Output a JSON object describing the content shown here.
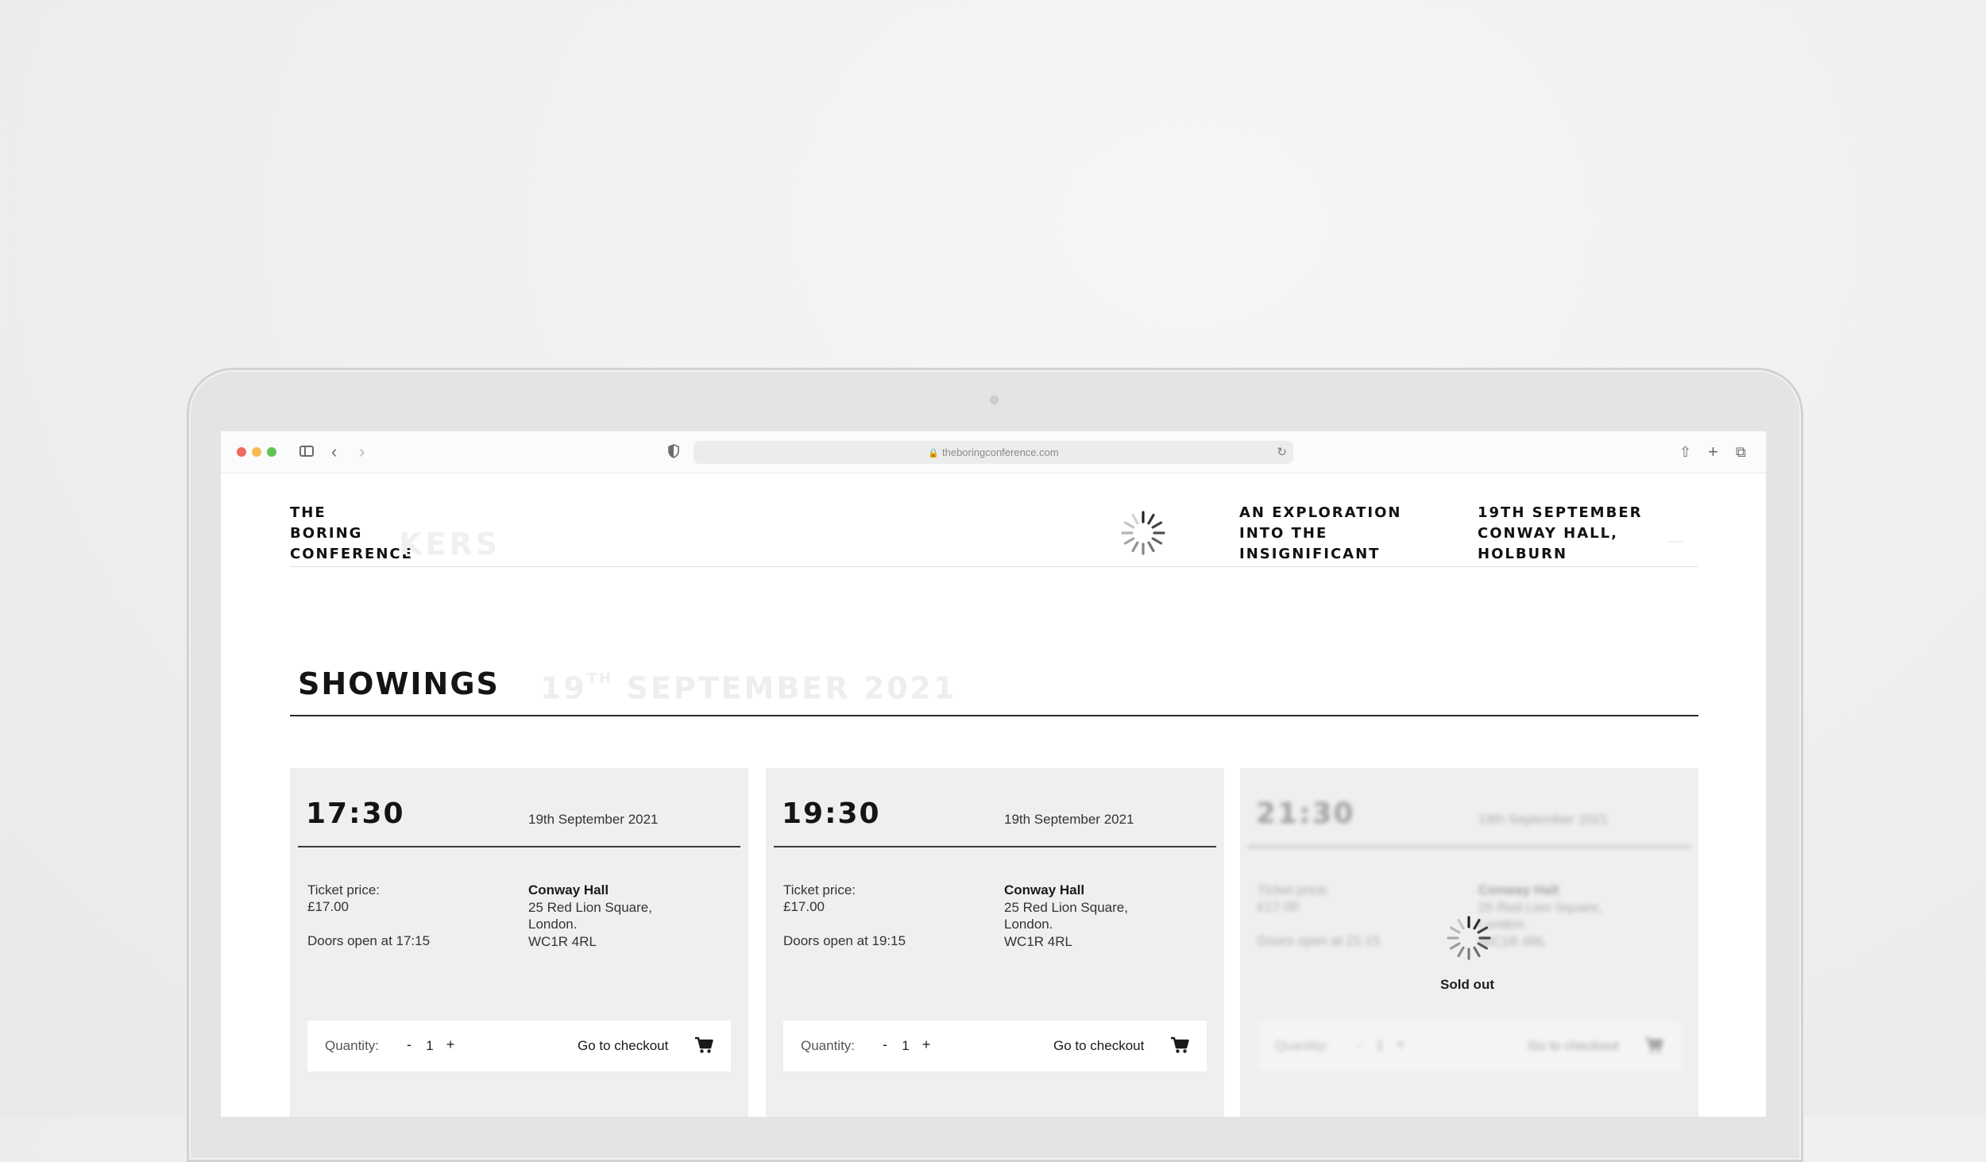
{
  "browser": {
    "url": "theboringconference.com"
  },
  "header": {
    "logo_lines": [
      "THE",
      "BORING",
      "CONFERENCE"
    ],
    "ghost_nav": "KERS",
    "tagline_lines": [
      "AN EXPLORATION",
      "INTO THE",
      "INSIGNIFICANT"
    ],
    "details_lines": [
      "19TH SEPTEMBER",
      "CONWAY HALL,",
      "HOLBURN"
    ]
  },
  "showings": {
    "title": "SHOWINGS",
    "date_prefix": "19",
    "date_sup": "TH",
    "date_rest": "SEPTEMBER 2021",
    "cards": [
      {
        "time": "17:30",
        "date": "19th September 2021",
        "price_label": "Ticket price:",
        "price": "£17.00",
        "doors": "Doors open at 17:15",
        "venue_name": "Conway Hall",
        "venue_lines": [
          "25 Red Lion Square,",
          "London.",
          "WC1R 4RL"
        ],
        "quantity_label": "Quantity:",
        "minus": "-",
        "quantity": "1",
        "plus": "+",
        "checkout": "Go to checkout",
        "sold_out": false
      },
      {
        "time": "19:30",
        "date": "19th September 2021",
        "price_label": "Ticket price:",
        "price": "£17.00",
        "doors": "Doors open at 19:15",
        "venue_name": "Conway Hall",
        "venue_lines": [
          "25 Red Lion Square,",
          "London.",
          "WC1R 4RL"
        ],
        "quantity_label": "Quantity:",
        "minus": "-",
        "quantity": "1",
        "plus": "+",
        "checkout": "Go to checkout",
        "sold_out": false
      },
      {
        "time": "21:30",
        "date": "19th September 2021",
        "price_label": "Ticket price:",
        "price": "£17.00",
        "doors": "Doors open at 21:15",
        "venue_name": "Conway Hall",
        "venue_lines": [
          "25 Red Lion Square,",
          "London.",
          "WC1R 4RL"
        ],
        "quantity_label": "Quantity:",
        "minus": "-",
        "quantity": "1",
        "plus": "+",
        "checkout": "Go to checkout",
        "sold_out": true,
        "sold_out_label": "Sold out"
      }
    ]
  },
  "icons": {
    "spinner": "loading-spinner-icon",
    "cart": "shopping-cart-icon",
    "lock": "lock-icon",
    "reload": "reload-icon",
    "share": "share-icon",
    "new_tab": "plus-icon",
    "tabs": "tab-overview-icon"
  },
  "colors": {
    "accent_dark": "#141414",
    "card_bg": "#efefef",
    "traffic_red": "#ee6a5e",
    "traffic_yellow": "#f5bd4f",
    "traffic_green": "#61c454"
  }
}
